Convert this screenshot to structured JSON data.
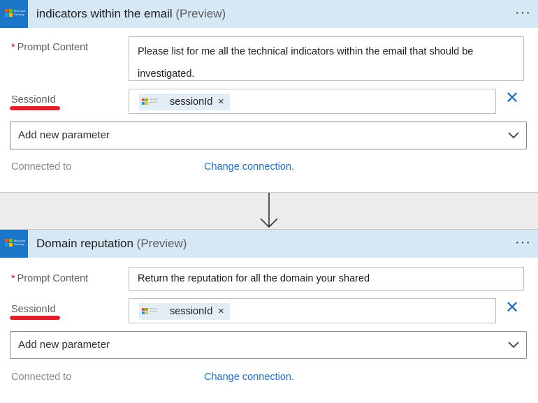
{
  "actions": [
    {
      "title": "indicators within the email",
      "title_suffix": "(Preview)",
      "more_label": "···",
      "prompt_label": "Prompt Content",
      "required_mark": "*",
      "prompt_value_lines": [
        "Please list for me all the technical indicators within the email that should be",
        "investigated."
      ],
      "session_label": "SessionId",
      "session_token": "sessionId",
      "token_remove": "×",
      "clear_label": "✕",
      "add_param_label": "Add new parameter",
      "connected_label": "Connected to",
      "change_connection": "Change connection."
    },
    {
      "title": "Domain reputation",
      "title_suffix": "(Preview)",
      "more_label": "···",
      "prompt_label": "Prompt Content",
      "required_mark": "*",
      "prompt_value": "Return the reputation for all the domain your shared",
      "session_label": "SessionId",
      "session_token": "sessionId",
      "token_remove": "×",
      "clear_label": "✕",
      "add_param_label": "Add new parameter",
      "connected_label": "Connected to",
      "change_connection": "Change connection."
    }
  ],
  "logo_text": [
    "Microsoft",
    "Security"
  ],
  "icons": {
    "logo": "microsoft-security-logo",
    "more": "ellipsis-icon",
    "token": "microsoft-security-token-icon",
    "remove": "close-icon",
    "clear": "clear-x-icon",
    "chevron": "chevron-down-icon",
    "flow_arrow": "arrow-down-icon"
  },
  "colors": {
    "header_bg": "#d7e8f5",
    "logo_bg": "#1b76c8",
    "link": "#1f6fc5",
    "required": "#c50f1f",
    "highlight_underline": "#e0202a",
    "token_bg": "#e4edf6",
    "ms_red": "#f25022",
    "ms_green": "#7fba00",
    "ms_blue": "#00a4ef",
    "ms_yellow": "#ffb900"
  }
}
